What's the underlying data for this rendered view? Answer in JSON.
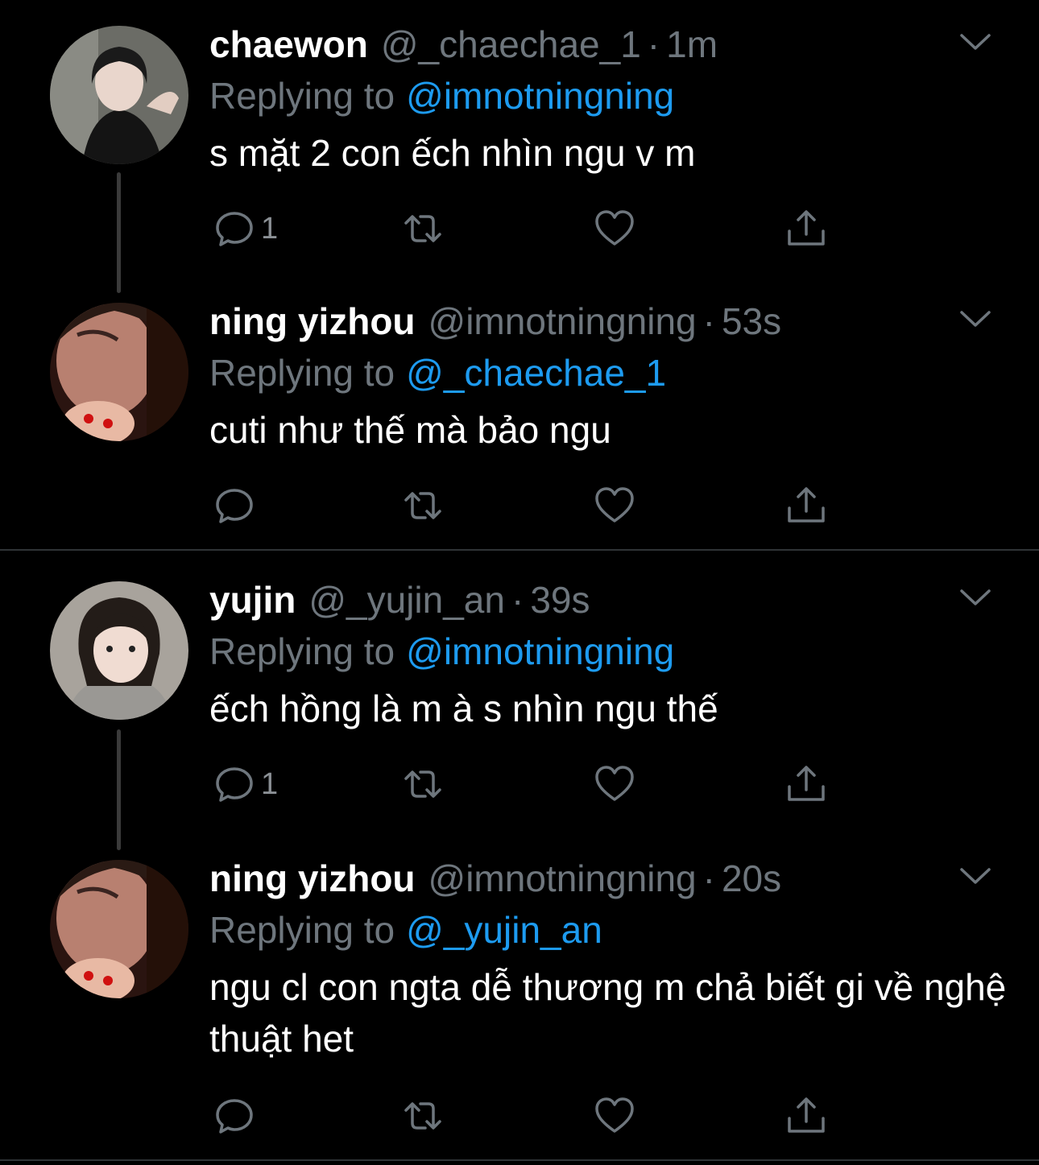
{
  "colors": {
    "background": "#000000",
    "text": "#ffffff",
    "muted": "#6e767d",
    "link": "#1d9bf0",
    "divider": "#2f3336"
  },
  "tweets": [
    {
      "name": "chaewon",
      "handle": "@_chaechae_1",
      "dot": "·",
      "time": "1m",
      "reply_prefix": "Replying to",
      "reply_to": "@imnotningning",
      "text": "s mặt 2 con ếch nhìn ngu v m",
      "reply_count": "1",
      "icons": [
        "reply-icon",
        "retweet-icon",
        "like-icon",
        "share-icon",
        "chevron-down-icon"
      ]
    },
    {
      "name": "ning yizhou",
      "handle": "@imnotningning",
      "dot": "·",
      "time": "53s",
      "reply_prefix": "Replying to",
      "reply_to": "@_chaechae_1",
      "text": "cuti như thế mà bảo ngu",
      "reply_count": ""
    },
    {
      "name": "yujin",
      "handle": "@_yujin_an",
      "dot": "·",
      "time": "39s",
      "reply_prefix": "Replying to",
      "reply_to": "@imnotningning",
      "text": "ếch hồng là m à s nhìn ngu thế",
      "reply_count": "1"
    },
    {
      "name": "ning yizhou",
      "handle": "@imnotningning",
      "dot": "·",
      "time": "20s",
      "reply_prefix": "Replying to",
      "reply_to": "@_yujin_an",
      "text": "ngu cl con ngta dễ thương m chả biết gi về nghệ thuật het",
      "reply_count": ""
    }
  ]
}
